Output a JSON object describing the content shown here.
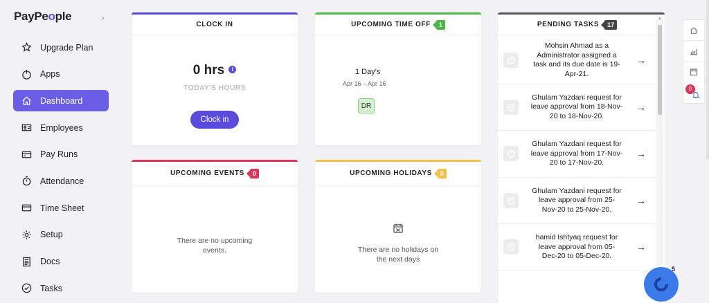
{
  "sidebar": {
    "logo_prefix": "PayPe",
    "logo_accent": "o",
    "logo_suffix": "ple",
    "items": [
      {
        "label": "Upgrade Plan",
        "icon": "star-icon"
      },
      {
        "label": "Apps",
        "icon": "power-icon"
      },
      {
        "label": "Dashboard",
        "icon": "home-icon",
        "active": true
      },
      {
        "label": "Employees",
        "icon": "id-card-icon"
      },
      {
        "label": "Pay Runs",
        "icon": "credit-card-icon"
      },
      {
        "label": "Attendance",
        "icon": "stopwatch-icon"
      },
      {
        "label": "Time Sheet",
        "icon": "card-icon"
      },
      {
        "label": "Setup",
        "icon": "gear-icon"
      },
      {
        "label": "Docs",
        "icon": "docs-icon"
      },
      {
        "label": "Tasks",
        "icon": "check-circle-icon"
      }
    ]
  },
  "clock_in": {
    "title": "CLOCK IN",
    "hours": "0 hrs",
    "info": "i",
    "subtitle": "TODAY'S HOURS",
    "button": "Clock in"
  },
  "time_off": {
    "title": "UPCOMING TIME OFF",
    "count": "1",
    "days": "1 Day's",
    "range": "Apr 16 – Apr 16",
    "avatar": "DR"
  },
  "events": {
    "title": "UPCOMING EVENTS",
    "count": "0",
    "empty_line1": "There are no upcoming",
    "empty_line2": "events."
  },
  "holidays": {
    "title": "UPCOMING HOLIDAYS",
    "count": "0",
    "empty_line1": "There are no holidays on",
    "empty_line2": "the next days"
  },
  "tasks": {
    "title": "PENDING TASKS",
    "count": "17",
    "items": [
      {
        "l1": "Mohsin Ahmad as a",
        "l2": "Administrator assigned a",
        "l3": "task and its due date is 19-",
        "l4": "Apr-21."
      },
      {
        "l1": "Ghulam Yazdani request for",
        "l2": "leave approval from 18-Nov-",
        "l3": "20 to 18-Nov-20.",
        "l4": ""
      },
      {
        "l1": "Ghulam Yazdani request for",
        "l2": "leave approval from 17-Nov-",
        "l3": "20 to 17-Nov-20.",
        "l4": ""
      },
      {
        "l1": "Ghulam Yazdani request for",
        "l2": "leave approval from 25-",
        "l3": "Nov-20 to 25-Nov-20.",
        "l4": ""
      },
      {
        "l1": "hamid Ishtyaq request for",
        "l2": "leave approval from 05-",
        "l3": "Dec-20 to 05-Dec-20.",
        "l4": ""
      }
    ]
  },
  "right_bar": {
    "notification_count": "0"
  },
  "fab": {
    "count": "5"
  },
  "colors": {
    "primary": "#5b4bdb",
    "clock_border": "#5b4bdb",
    "timeoff_border": "#4cb848",
    "events_border": "#d9385a",
    "holidays_border": "#f3c04b",
    "tasks_border": "#555555"
  }
}
